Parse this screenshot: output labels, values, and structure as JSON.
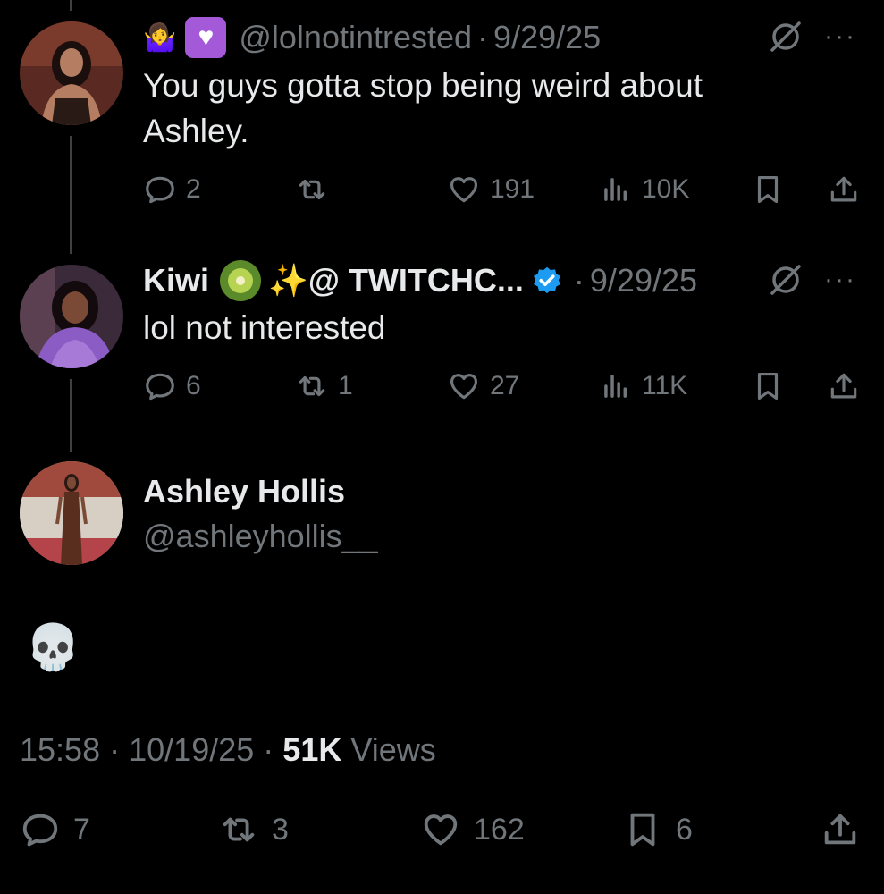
{
  "reply1": {
    "author_emoji": "🤷‍♀️",
    "badge_emoji": "💟",
    "handle": "@lolnotintrested",
    "separator": "·",
    "date": "9/29/25",
    "text": "You guys gotta stop being weird about Ashley.",
    "more_label": "···",
    "counts": {
      "replies": "2",
      "reposts": "",
      "likes": "191",
      "views": "10K"
    }
  },
  "reply2": {
    "display_name": "Kiwi",
    "name_suffix": "✨@ TWITCHC...",
    "separator": "·",
    "date": "9/29/25",
    "text": "lol not interested",
    "more_label": "···",
    "counts": {
      "replies": "6",
      "reposts": "1",
      "likes": "27",
      "views": "11K"
    }
  },
  "main": {
    "display_name": "Ashley Hollis",
    "handle": "@ashleyhollis__",
    "text": "💀",
    "time": "15:58",
    "separator": "·",
    "date": "10/19/25",
    "views_count": "51K",
    "views_label": "Views",
    "counts": {
      "replies": "7",
      "reposts": "3",
      "likes": "162",
      "bookmarks": "6"
    }
  },
  "colors": {
    "background": "#000000",
    "primary_text": "#e7e9ea",
    "secondary_text": "#71767b",
    "thread_line": "#3e4144",
    "verified": "#1d9bf0",
    "heart_badge": "#a45ad8"
  }
}
